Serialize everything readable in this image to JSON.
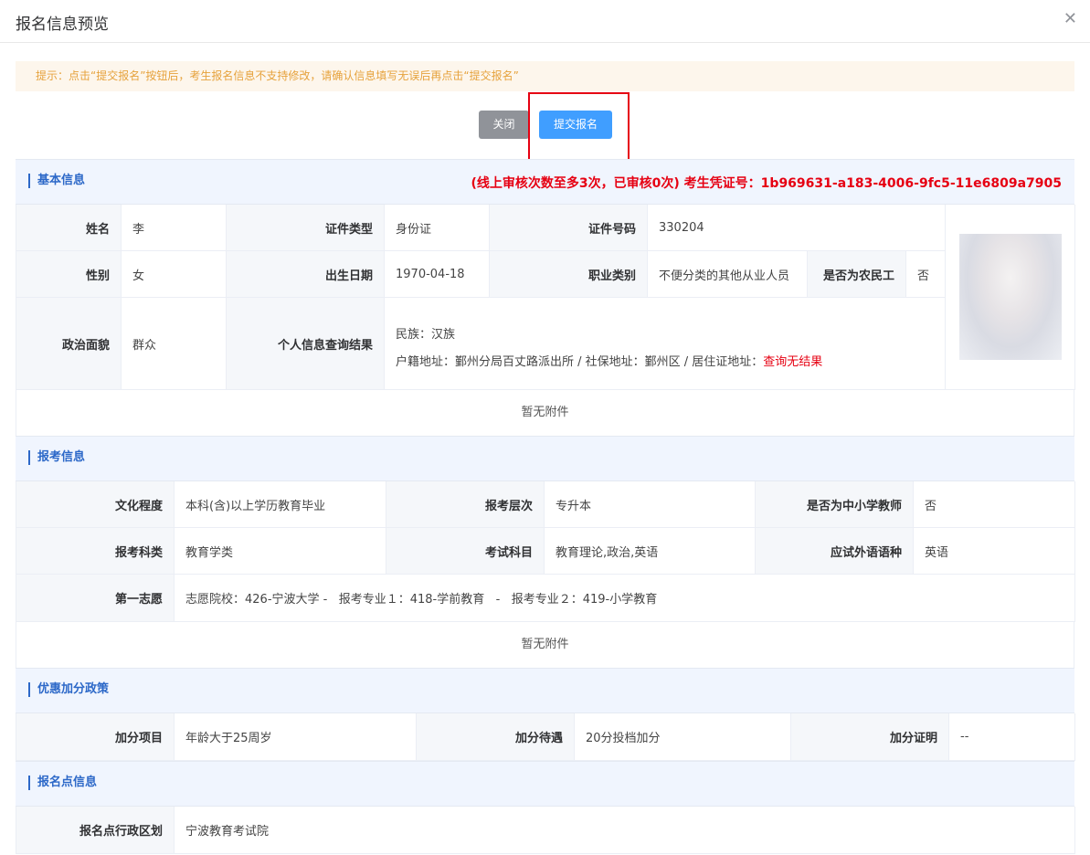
{
  "dialog": {
    "title": "报名信息预览",
    "close_icon": "close-icon"
  },
  "tip": "提示：点击“提交报名”按钮后，考生报名信息不支持修改，请确认信息填写无误后再点击“提交报名”",
  "buttons": {
    "close": "关闭",
    "submit": "提交报名"
  },
  "basic": {
    "section_title": "基本信息",
    "audit_note": "(线上审核次数至多3次，已审核0次) 考生凭证号：1b969631-a183-4006-9fc5-11e6809a7905",
    "name_label": "姓名",
    "name": "李",
    "id_type_label": "证件类型",
    "id_type": "身份证",
    "id_no_label": "证件号码",
    "id_no": "330204",
    "gender_label": "性别",
    "gender": "女",
    "birth_label": "出生日期",
    "birth": "1970-04-18",
    "job_label": "职业类别",
    "job": "不便分类的其他从业人员",
    "farmer_label": "是否为农民工",
    "farmer": "否",
    "politics_label": "政治面貌",
    "politics": "群众",
    "query_label": "个人信息查询结果",
    "nation": "民族：汉族",
    "address_prefix": "户籍地址：鄞州分局百丈路派出所 / 社保地址：鄞州区 / 居住证地址：",
    "address_result": "查询无结果",
    "attachment": "暂无附件"
  },
  "exam": {
    "section_title": "报考信息",
    "edu_label": "文化程度",
    "edu": "本科(含)以上学历教育毕业",
    "level_label": "报考层次",
    "level": "专升本",
    "teacher_label": "是否为中小学教师",
    "teacher": "否",
    "category_label": "报考科类",
    "category": "教育学类",
    "subject_label": "考试科目",
    "subject": "教育理论,政治,英语",
    "lang_label": "应试外语语种",
    "lang": "英语",
    "wish_label": "第一志愿",
    "wish": "志愿院校：426-宁波大学 -   报考专业１：418-学前教育   -   报考专业２：419-小学教育",
    "attachment": "暂无附件"
  },
  "bonus": {
    "section_title": "优惠加分政策",
    "item_label": "加分项目",
    "item": "年龄大于25周岁",
    "treat_label": "加分待遇",
    "treat": "20分投档加分",
    "proof_label": "加分证明",
    "proof": "--"
  },
  "site": {
    "section_title": "报名点信息",
    "region_label": "报名点行政区划",
    "region": "宁波教育考试院"
  }
}
